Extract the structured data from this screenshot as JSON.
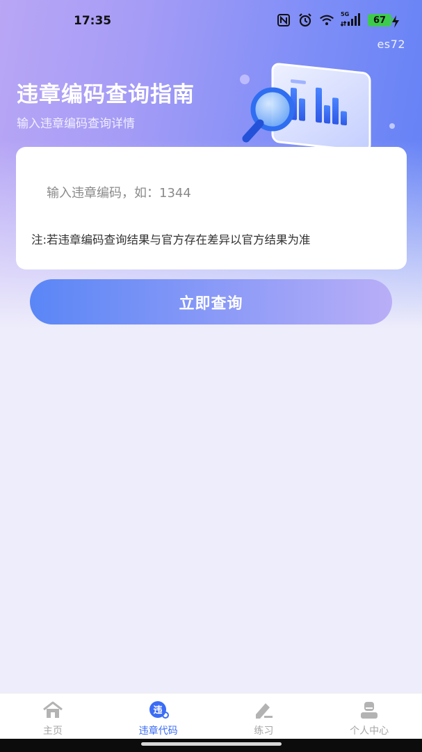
{
  "status_bar": {
    "time": "17:35",
    "network_label": "5G",
    "battery": "67",
    "icons": [
      "nfc-icon",
      "alarm-icon",
      "wifi-icon",
      "signal-icon",
      "battery-icon",
      "charging-icon"
    ]
  },
  "header": {
    "version": "es72",
    "title": "违章编码查询指南",
    "subtitle": "输入违章编码查询详情"
  },
  "form": {
    "input_value": "",
    "input_placeholder": "输入违章编码，如：1344",
    "note": "注:若违章编码查询结果与官方存在差异以官方结果为准",
    "submit_label": "立即查询"
  },
  "tabbar": {
    "items": [
      {
        "label": "主页",
        "icon": "home-icon",
        "active": false
      },
      {
        "label": "违章代码",
        "icon": "violation-code-icon",
        "active": true
      },
      {
        "label": "练习",
        "icon": "practice-icon",
        "active": false
      },
      {
        "label": "个人中心",
        "icon": "profile-icon",
        "active": false
      }
    ]
  },
  "colors": {
    "accent": "#3b6cf5",
    "header_gradient_start": "#b9a6f5",
    "header_gradient_end": "#5f7ff5",
    "page_background": "#eeedfb"
  }
}
